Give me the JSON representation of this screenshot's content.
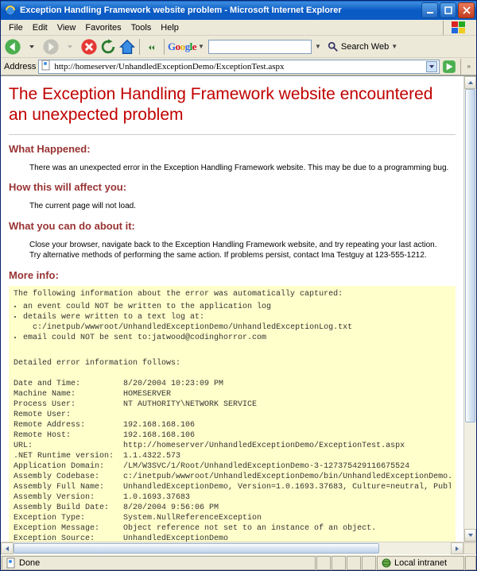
{
  "window": {
    "title": "Exception Handling Framework website problem - Microsoft Internet Explorer"
  },
  "menus": {
    "file": "File",
    "edit": "Edit",
    "view": "View",
    "favorites": "Favorites",
    "tools": "Tools",
    "help": "Help"
  },
  "toolbar": {
    "google_label": "Google",
    "search_web_label": "Search Web"
  },
  "address": {
    "label": "Address",
    "url": "http://homeserver/UnhandledExceptionDemo/ExceptionTest.aspx"
  },
  "page": {
    "title": "The Exception Handling Framework website encountered an unexpected problem",
    "sections": {
      "what_happened": {
        "heading": "What Happened:",
        "text": "There was an unexpected error in the Exception Handling Framework website. This may be due to a programming bug."
      },
      "affect": {
        "heading": "How this will affect you:",
        "text": "The current page will not load."
      },
      "todo": {
        "heading": "What you can do about it:",
        "text": "Close your browser, navigate back to the Exception Handling Framework website, and try repeating your last action. Try alternative methods of performing the same action. If problems persist, contact Ima Testguy at 123-555-1212."
      },
      "moreinfo": {
        "heading": "More info:",
        "intro": "The following information about the error was automatically captured:",
        "bullets": [
          "an event could NOT be written to the application log",
          "details were written to a text log at:",
          "c:/inetpub/wwwroot/UnhandledExceptionDemo/UnhandledExceptionLog.txt",
          "email could NOT be sent to:jatwood@codinghorror.com"
        ],
        "detail_intro": "Detailed error information follows:",
        "kv": {
          "date_time": "Date and Time:         8/20/2004 10:23:09 PM",
          "machine": "Machine Name:          HOMESERVER",
          "process_user": "Process User:          NT AUTHORITY\\NETWORK SERVICE",
          "remote_user": "Remote User:",
          "remote_addr": "Remote Address:        192.168.168.106",
          "remote_host": "Remote Host:           192.168.168.106",
          "url": "URL:                   http://homeserver/UnhandledExceptionDemo/ExceptionTest.aspx",
          "blank1": "",
          "net_runtime": ".NET Runtime version:  1.1.4322.573",
          "app_domain": "Application Domain:    /LM/W3SVC/1/Root/UnhandledExceptionDemo-3-127375429116675524",
          "asm_codebase": "Assembly Codebase:     c:/inetpub/wwwroot/UnhandledExceptionDemo/bin/UnhandledExceptionDemo.DLL",
          "asm_fullname": "Assembly Full Name:    UnhandledExceptionDemo, Version=1.0.1693.37683, Culture=neutral, PublicKeyToken=nu",
          "asm_version": "Assembly Version:      1.0.1693.37683",
          "asm_builddate": "Assembly Build Date:   8/20/2004 9:56:06 PM",
          "blank2": "",
          "exc_type": "Exception Type:        System.NullReferenceException",
          "exc_message": "Exception Message:     Object reference not set to an instance of an object.",
          "exc_source": "Exception Source:      UnhandledExceptionDemo"
        }
      }
    }
  },
  "status": {
    "done": "Done",
    "zone": "Local intranet"
  }
}
